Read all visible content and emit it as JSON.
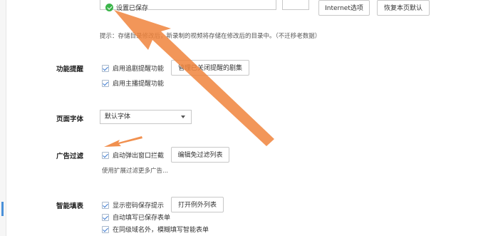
{
  "status": {
    "saved_text": "设置已保存"
  },
  "toolbar": {
    "internet_options": "Internet选项",
    "restore_defaults": "恢复本页默认"
  },
  "storage": {
    "hint": "提示：存储目录修改后，新录制的视频将存储在修改后的目录中。（不迁移老数据）"
  },
  "reminder": {
    "label": "功能提醒",
    "options": [
      "启用追剧提醒功能",
      "启用主播提醒功能"
    ],
    "manage_button": "管理已关闭提醒的剧集"
  },
  "font": {
    "label": "页面字体",
    "selected": "默认字体"
  },
  "adfilter": {
    "label": "广告过滤",
    "option": "启动弹出窗口拦截",
    "edit_button": "编辑免过滤列表",
    "note": "使用扩展过滤更多广告..."
  },
  "autofill": {
    "label": "智能填表",
    "options": [
      "显示密码保存提示",
      "自动填写已保存表单",
      "在同级域名外，模糊填写智能表单"
    ],
    "exceptions_button": "打开例外列表"
  },
  "icons": {
    "saved": "check-circle-icon",
    "dropdown": "chevron-down-icon",
    "annotation": "arrow-annotation"
  },
  "colors": {
    "accent": "#3d7bd2",
    "success": "#3bb54a",
    "annotation": "#f0843c"
  }
}
